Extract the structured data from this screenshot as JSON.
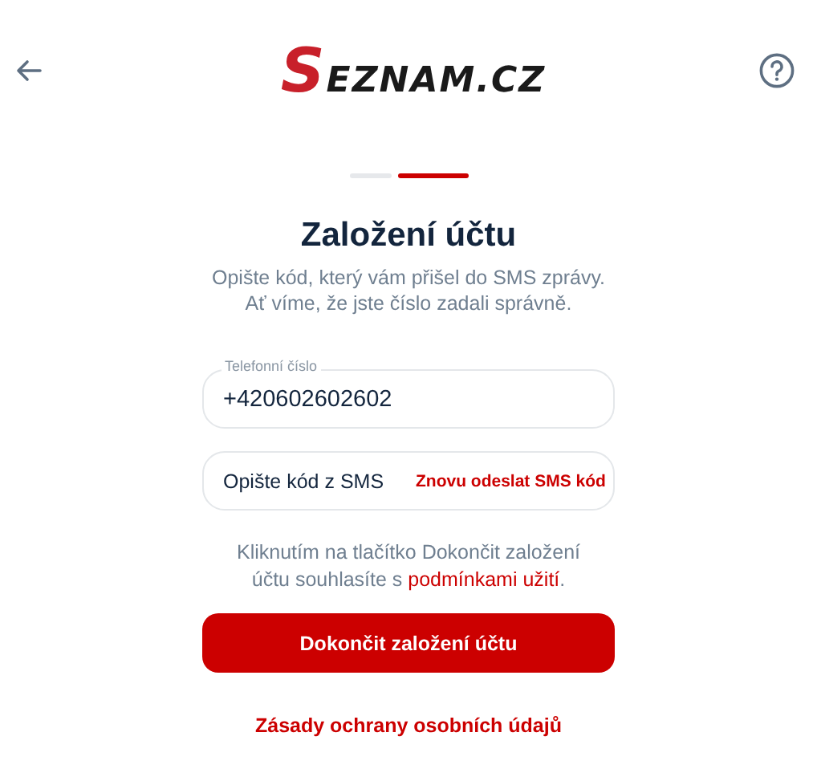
{
  "logo": {
    "initial": "S",
    "rest": "EZNAM.CZ"
  },
  "steps": [
    {
      "selected": false
    },
    {
      "selected": true
    }
  ],
  "title": "Založení účtu",
  "subtitle": [
    "Opište kód, který vám přišel do SMS zprávy.",
    "Ať víme, že jste číslo zadali správně."
  ],
  "phone_field": {
    "label": "Telefonní číslo",
    "value": "+420602602602"
  },
  "sms_field": {
    "placeholder": "Opište kód z SMS",
    "resend_link": "Znovu odeslat SMS kód"
  },
  "consent": {
    "text": "Kliknutím na tlačítko Dokončit založení účtu souhlasíte s",
    "link": "podmínkami užití",
    "after": "."
  },
  "submit_button": "Dokončit založení účtu",
  "privacy_link": "Zásady ochrany osobních údajů"
}
